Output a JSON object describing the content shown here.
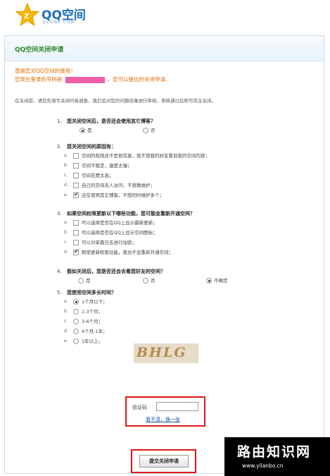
{
  "logo": {
    "title": "QQ空间",
    "subtitle": "QZONE.COM",
    "star_color": "#f5b700"
  },
  "header": {
    "title": "QQ空间关闭申请"
  },
  "thanks": {
    "line1": "感谢您对QQ空间的使用！",
    "line2_prefix": "您现在登录的号码是",
    "line2_suffix": "，您可以提出的关闭申请。"
  },
  "intro": "在关闭前，请您先填写关闭问卷调查，我们会对您的问题结果进行审核，审核通过后即可完全关闭。",
  "questions": [
    {
      "num": "1.",
      "text": "您关闭空间后，是否还会使用其它博客？",
      "options": [
        {
          "label": "是",
          "checked": true
        },
        {
          "label": "否",
          "checked": false
        }
      ]
    },
    {
      "num": "2.",
      "text": "您关闭空间的原因有：",
      "options": [
        {
          "letter": "a.",
          "label": "空间的权限还不是很完善，我不想我的好友看到我的空间内容；",
          "checked": false
        },
        {
          "letter": "b.",
          "label": "空间不稳定，速度太慢；",
          "checked": false
        },
        {
          "letter": "c.",
          "label": "空间花费太高；",
          "checked": false
        },
        {
          "letter": "d.",
          "label": "自己的空间无人访问，不想再维护；",
          "checked": false
        },
        {
          "letter": "e.",
          "label": "还在使用其它博客，不想同时维护多个；",
          "checked": true
        }
      ]
    },
    {
      "num": "3.",
      "text": "如果空间权限更新以下哪些功能，您可能会重新开通空间？",
      "options": [
        {
          "letter": "a.",
          "label": "可以选择是否在QQ上显示最新更新；",
          "checked": false
        },
        {
          "letter": "b.",
          "label": "可以选择是否在QQ上显示空间图标；",
          "checked": false
        },
        {
          "letter": "c.",
          "label": "可以对单篇日志进行加密；",
          "checked": false
        },
        {
          "letter": "d.",
          "label": "即使更新权限功能，我也不会重新开通空间；",
          "checked": true
        }
      ]
    },
    {
      "num": "4.",
      "text": "假如关闭后，您是否还会去看您好友的空间？",
      "options": [
        {
          "label": "是",
          "checked": false
        },
        {
          "label": "否",
          "checked": false
        },
        {
          "label": "不确定",
          "checked": true
        }
      ]
    },
    {
      "num": "5.",
      "text": "您使用空间多长时间？",
      "options": [
        {
          "letter": "a.",
          "label": "1个月以下；",
          "checked": true
        },
        {
          "letter": "b.",
          "label": "1-3个月；",
          "checked": false
        },
        {
          "letter": "c.",
          "label": "3-6个月；",
          "checked": false
        },
        {
          "letter": "d.",
          "label": "6个月-1年；",
          "checked": false
        },
        {
          "letter": "e.",
          "label": "1年以上；",
          "checked": false
        }
      ]
    }
  ],
  "captcha": {
    "text": "BHLG"
  },
  "verify": {
    "label": "验证码",
    "value": "",
    "refresh_link": "看不清，换一张"
  },
  "submit": {
    "label": "提交关闭申请"
  },
  "watermark": {
    "title": "路由知识网",
    "url": "www.yilanbo.cn"
  }
}
